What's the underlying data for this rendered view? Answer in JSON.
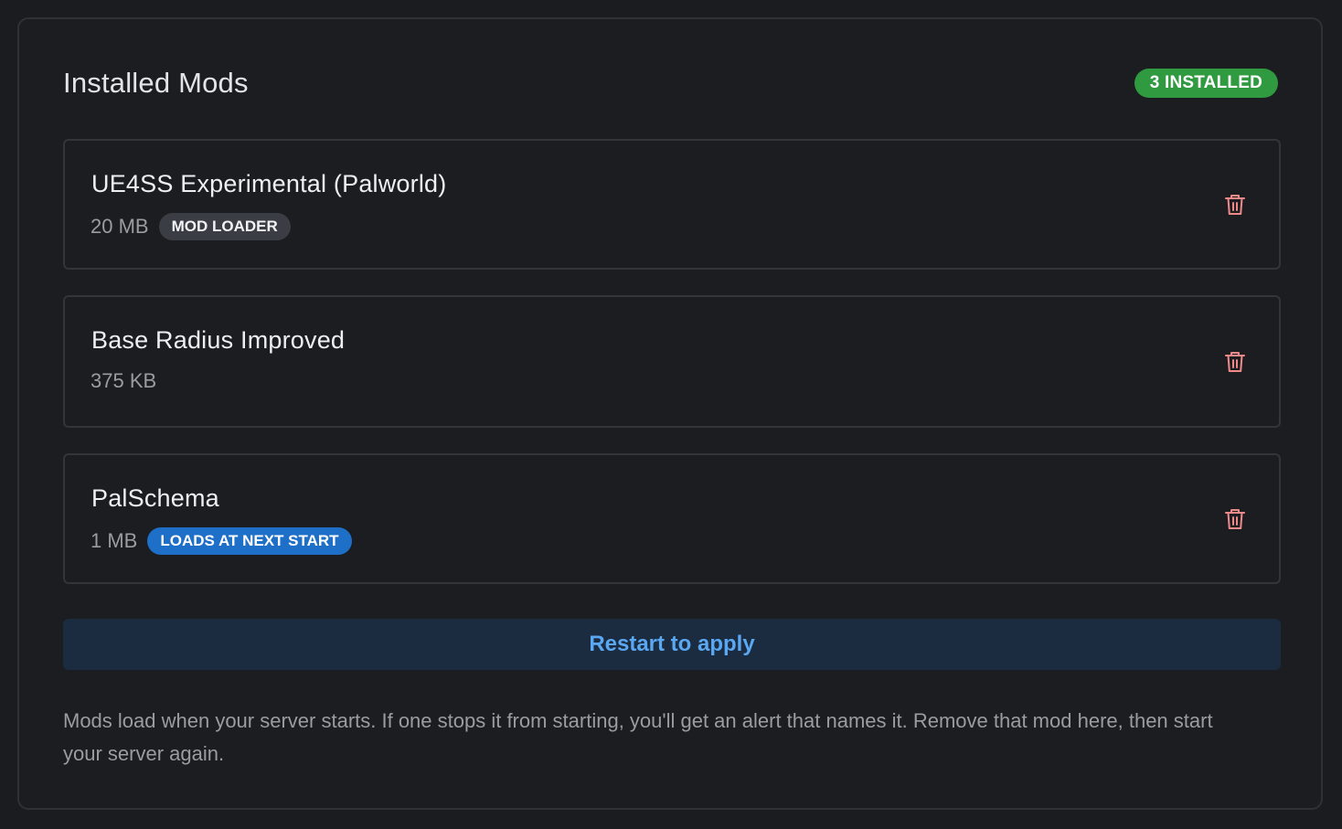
{
  "header": {
    "title": "Installed Mods",
    "count_badge": "3 INSTALLED"
  },
  "mods": [
    {
      "name": "UE4SS Experimental (Palworld)",
      "size": "20 MB",
      "tag": "MOD LOADER",
      "tag_style": "gray"
    },
    {
      "name": "Base Radius Improved",
      "size": "375 KB"
    },
    {
      "name": "PalSchema",
      "size": "1 MB",
      "tag": "LOADS AT NEXT START",
      "tag_style": "blue"
    }
  ],
  "restart_label": "Restart to apply",
  "help_text": "Mods load when your server starts. If one stops it from starting, you'll get an alert that names it. Remove that mod here, then start your server again.",
  "icons": {
    "delete": "trash-icon"
  },
  "colors": {
    "background": "#1b1c20",
    "count_badge": "#2f9a3f",
    "mod_loader_tag": "#3a3d44",
    "next_start_tag": "#1d6fc8",
    "restart_button_bg": "#1b2b40",
    "restart_button_text": "#5aa7f2",
    "trash_icon": "#f08a8a"
  }
}
